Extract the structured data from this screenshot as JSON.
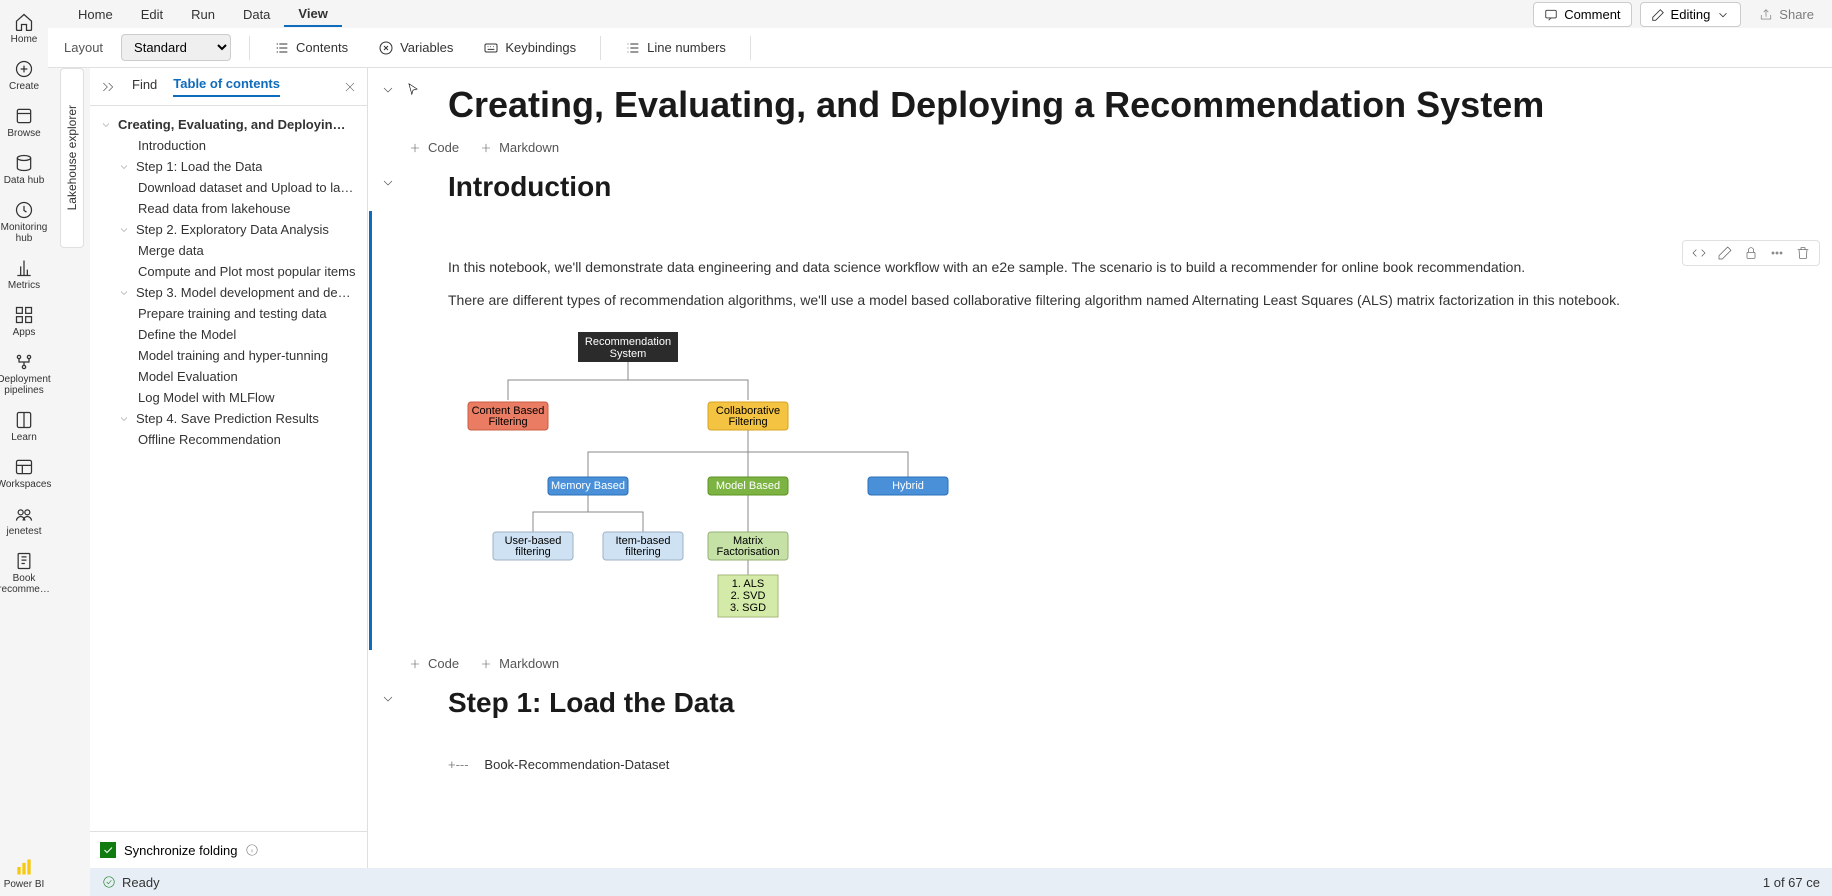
{
  "left_nav": [
    {
      "label": "Home"
    },
    {
      "label": "Create"
    },
    {
      "label": "Browse"
    },
    {
      "label": "Data hub"
    },
    {
      "label": "Monitoring hub"
    },
    {
      "label": "Metrics"
    },
    {
      "label": "Apps"
    },
    {
      "label": "Deployment pipelines"
    },
    {
      "label": "Learn"
    },
    {
      "label": "Workspaces"
    },
    {
      "label": "jenetest"
    },
    {
      "label": "Book recomme…"
    },
    {
      "label": "Power BI"
    }
  ],
  "top_menu": {
    "items": [
      "Home",
      "Edit",
      "Run",
      "Data",
      "View"
    ],
    "active": 4
  },
  "top_right": {
    "comment": "Comment",
    "editing": "Editing",
    "share": "Share"
  },
  "ribbon": {
    "layout_lbl": "Layout",
    "layout_value": "Standard",
    "contents": "Contents",
    "variables": "Variables",
    "keybindings": "Keybindings",
    "linenumbers": "Line numbers"
  },
  "lakehouse_tab": "Lakehouse explorer",
  "toc_hdr": {
    "find": "Find",
    "toc": "Table of contents"
  },
  "toc": [
    {
      "lvl": "lvl0",
      "chev": true,
      "txt": "Creating, Evaluating, and Deployin…"
    },
    {
      "lvl": "lvl1",
      "chev": false,
      "txt": "Introduction"
    },
    {
      "lvl": "lvl1h",
      "chev": true,
      "txt": "Step 1: Load the Data"
    },
    {
      "lvl": "lvl2",
      "chev": false,
      "txt": "Download dataset and Upload to lakeh..."
    },
    {
      "lvl": "lvl2",
      "chev": false,
      "txt": "Read data from lakehouse"
    },
    {
      "lvl": "lvl1h",
      "chev": true,
      "txt": "Step 2. Exploratory Data Analysis"
    },
    {
      "lvl": "lvl2",
      "chev": false,
      "txt": "Merge data"
    },
    {
      "lvl": "lvl2",
      "chev": false,
      "txt": "Compute and Plot most popular items"
    },
    {
      "lvl": "lvl1h",
      "chev": true,
      "txt": "Step 3. Model development and deploy"
    },
    {
      "lvl": "lvl2",
      "chev": false,
      "txt": "Prepare training and testing data"
    },
    {
      "lvl": "lvl2",
      "chev": false,
      "txt": "Define the Model"
    },
    {
      "lvl": "lvl2",
      "chev": false,
      "txt": "Model training and hyper-tunning"
    },
    {
      "lvl": "lvl2",
      "chev": false,
      "txt": "Model Evaluation"
    },
    {
      "lvl": "lvl2",
      "chev": false,
      "txt": "Log Model with MLFlow"
    },
    {
      "lvl": "lvl1h",
      "chev": true,
      "txt": "Step 4. Save Prediction Results"
    },
    {
      "lvl": "lvl2",
      "chev": false,
      "txt": "Offline Recommendation"
    }
  ],
  "toc_ftr": "Synchronize folding",
  "main": {
    "title": "Creating, Evaluating, and Deploying a Recommendation System",
    "code": "Code",
    "markdown": "Markdown",
    "intro_h": "Introduction",
    "p1": "In this notebook, we'll demonstrate data engineering and data science workflow with an e2e sample. The scenario is to build a recommender for online book recommendation.",
    "p2": "There are different types of recommendation algorithms, we'll use a model based collaborative filtering algorithm named Alternating Least Squares (ALS) matrix factorization in this notebook.",
    "step1_h": "Step 1: Load the Data",
    "code_fold_prefix": "+---",
    "code_fold": "Book-Recommendation-Dataset"
  },
  "diagram": {
    "root": "Recommendation\nSystem",
    "cbf": "Content Based\nFiltering",
    "cf": "Collaborative\nFiltering",
    "mem": "Memory Based",
    "mod": "Model Based",
    "hyb": "Hybrid",
    "ubf": "User-based\nfiltering",
    "ibf": "Item-based\nfiltering",
    "mf": "Matrix\nFactorisation",
    "algs": "1. ALS\n2. SVD\n3. SGD"
  },
  "status": {
    "ready": "Ready",
    "cells": "1 of 67 ce"
  }
}
